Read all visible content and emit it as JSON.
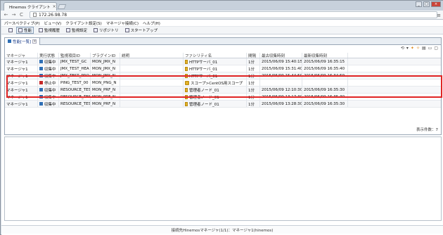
{
  "browser": {
    "tab_title": "Hinemos クライアント",
    "tab_close": "×",
    "url": "172.26.98.78",
    "back": "←",
    "forward": "→",
    "reload": "C",
    "menu": "≡",
    "min": "_",
    "max": "□",
    "close": "×"
  },
  "menubar": [
    "パースペクティブ(P)",
    "ビュー(V)",
    "クライアント設定(S)",
    "マネージャ接続(C)",
    "ヘルプ(H)"
  ],
  "perspectives": [
    {
      "label": "性能",
      "icon": "grid-icon"
    },
    {
      "label": "監視履歴",
      "icon": "history-icon"
    },
    {
      "label": "監視設定",
      "icon": "settings-icon"
    },
    {
      "label": "リポジトリ",
      "icon": "repository-icon"
    },
    {
      "label": "スタートアップ",
      "icon": "startup-icon"
    }
  ],
  "view": {
    "tab_label": "性能[一覧]",
    "tab_close": "×",
    "toolbar_icons": [
      "graph-icon",
      "filter-icon",
      "orange-refresh-icon",
      "orange-star-icon",
      "view-menu-icon",
      "minimize-icon",
      "maximize-icon"
    ],
    "toolbar_glyphs": [
      "⟲",
      "▾",
      "✦",
      "✧",
      "▤",
      "▭",
      "▢"
    ],
    "count_text": "表示件数：7"
  },
  "grid": {
    "headers": [
      "マネージャ",
      "実行状態",
      "監視項目ID",
      "プラグインID",
      "説明",
      "ファシリティ名",
      "間隔",
      "最古収集時刻",
      "最新収集時刻",
      ""
    ],
    "status_colors": {
      "running": "#2f6fb5",
      "stopped": "#c62828"
    },
    "rows": [
      {
        "manager": "マネージャ1",
        "status": "収集中",
        "status_key": "running",
        "monitor_id": "JMX_TEST_GC",
        "plugin_id": "MON_JMX_N",
        "desc": "",
        "facility": "HTTPサーバ_01",
        "fac_type": "node",
        "interval": "1分",
        "oldest": "2015/06/09 15:40:15",
        "latest": "2015/06/09 16:35:15"
      },
      {
        "manager": "マネージャ1",
        "status": "収集中",
        "status_key": "running",
        "monitor_id": "JMX_TEST_HEA",
        "plugin_id": "MON_JMX_N",
        "desc": "",
        "facility": "HTTPサーバ_01",
        "fac_type": "node",
        "interval": "1分",
        "oldest": "2015/06/09 15:31:40",
        "latest": "2015/06/09 16:35:40"
      },
      {
        "manager": "マネージャ1",
        "status": "収集中",
        "status_key": "running",
        "monitor_id": "JMX_TEST_PRO",
        "plugin_id": "MON_JMX_N",
        "desc": "",
        "facility": "HTTPサーバ_01",
        "fac_type": "node",
        "interval": "1分",
        "oldest": "2015/06/09 15:44:59",
        "latest": "2015/06/09 16:34:59"
      },
      {
        "manager": "マネージャ1",
        "status": "停止中",
        "status_key": "stopped",
        "monitor_id": "PING_TEST_00",
        "plugin_id": "MON_PNG_N",
        "desc": "",
        "facility": "スコープ>CentOS用スコープ",
        "fac_type": "scope",
        "interval": "1分",
        "oldest": "",
        "latest": ""
      },
      {
        "manager": "マネージャ1",
        "status": "収集中",
        "status_key": "running",
        "monitor_id": "RESOURCE_TES",
        "plugin_id": "MON_PRF_N",
        "desc": "",
        "facility": "管理者ノード_01",
        "fac_type": "node",
        "interval": "1分",
        "oldest": "2015/06/09 12:10:30",
        "latest": "2015/06/09 16:35:30"
      },
      {
        "manager": "マネージャ1",
        "status": "収集中",
        "status_key": "running",
        "monitor_id": "RESOURCE_TES",
        "plugin_id": "MON_PRF_N",
        "desc": "",
        "facility": "管理者ノード_01",
        "fac_type": "node",
        "interval": "1分",
        "oldest": "2015/06/09 13:17:30",
        "latest": "2015/06/09 16:35:30"
      },
      {
        "manager": "マネージャ1",
        "status": "収集中",
        "status_key": "running",
        "monitor_id": "RESOURCE_TES",
        "plugin_id": "MON_PRF_N",
        "desc": "",
        "facility": "管理者ノード_01",
        "fac_type": "node",
        "interval": "1分",
        "oldest": "2015/06/09 13:28:30",
        "latest": "2015/06/09 16:35:30"
      }
    ]
  },
  "statusbar": {
    "text": "接続先Hinemosマネージャ(1/1)：マネージャ1(hinemos)"
  }
}
